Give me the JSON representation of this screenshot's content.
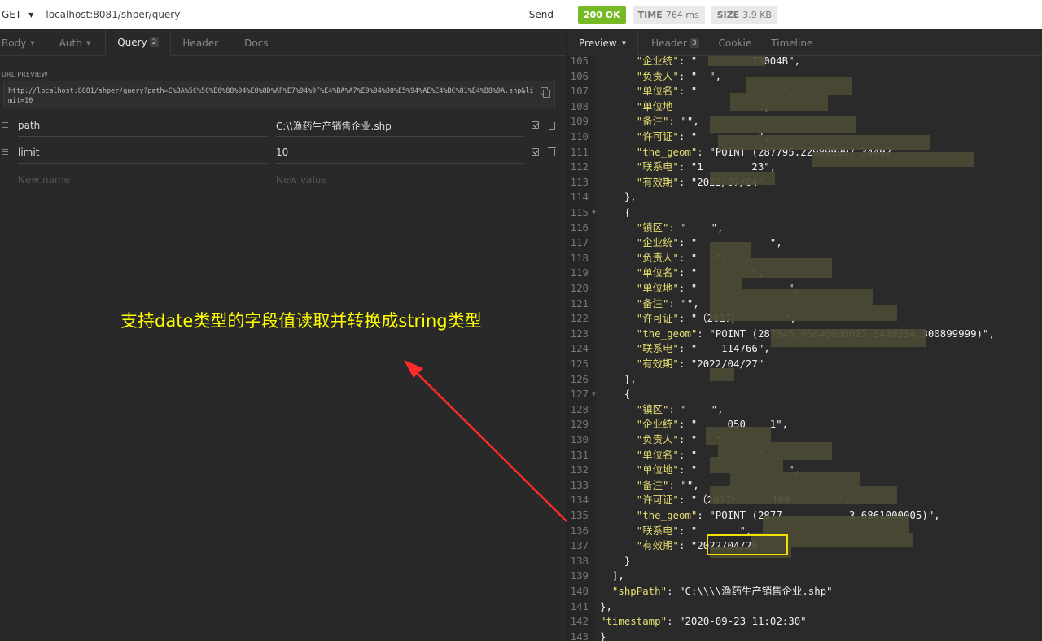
{
  "request": {
    "method": "GET",
    "url": "localhost:8081/shper/query",
    "send_label": "Send"
  },
  "response_meta": {
    "status": "200 OK",
    "time_label": "TIME",
    "time_value": "764 ms",
    "size_label": "SIZE",
    "size_value": "3.9 KB"
  },
  "left_tabs": [
    {
      "label": "Body"
    },
    {
      "label": "Auth"
    },
    {
      "label": "Query",
      "badge": "2"
    },
    {
      "label": "Header"
    },
    {
      "label": "Docs"
    }
  ],
  "url_preview": {
    "label": "URL PREVIEW",
    "text": "http://localhost:8081/shper/query?path=C%3A%5C%5C%E6%88%94%E8%8D%AF%E7%94%9F%E4%BA%A7%E9%94%80%E5%94%AE%E4%BC%81%E4%B8%9A.shp&limit=10"
  },
  "params": [
    {
      "name": "path",
      "value": "C:\\\\渔药生产销售企业.shp"
    },
    {
      "name": "limit",
      "value": "10"
    }
  ],
  "new_param": {
    "name_placeholder": "New name",
    "value_placeholder": "New value"
  },
  "annotation": "支持date类型的字段值读取并转换成string类型",
  "right_tabs": [
    {
      "label": "Preview"
    },
    {
      "label": "Header",
      "badge": "3"
    },
    {
      "label": "Cookie"
    },
    {
      "label": "Timeline"
    }
  ],
  "code_lines": [
    {
      "n": "105",
      "indent": "      ",
      "key": "\"企业统\"",
      "rest": ": \"         73004B\","
    },
    {
      "n": "106",
      "indent": "      ",
      "key": "\"负责人\"",
      "rest": ": \"  \","
    },
    {
      "n": "107",
      "indent": "      ",
      "key": "\"单位名\"",
      "rest": ": \"              \","
    },
    {
      "n": "108",
      "indent": "      ",
      "key": "\"单位地",
      "rest": "              \","
    },
    {
      "n": "109",
      "indent": "      ",
      "key": "\"备注\"",
      "rest": ": \"\","
    },
    {
      "n": "110",
      "indent": "      ",
      "key": "\"许可证\"",
      "rest": ": \"          \","
    },
    {
      "n": "111",
      "indent": "      ",
      "key": "\"the_geom\"",
      "rest": ": \"POINT (287795.229899997 34492"
    },
    {
      "n": "112",
      "indent": "      ",
      "key": "\"联系电\"",
      "rest": ": \"1        23\","
    },
    {
      "n": "113",
      "indent": "      ",
      "key": "\"有效期\"",
      "rest": ": \"2022/07/04\""
    },
    {
      "n": "114",
      "indent": "    ",
      "key": "",
      "rest": "},"
    },
    {
      "n": "115",
      "indent": "    ",
      "key": "",
      "rest": "{",
      "fold": true
    },
    {
      "n": "116",
      "indent": "      ",
      "key": "\"镇区\"",
      "rest": ": \"    \","
    },
    {
      "n": "117",
      "indent": "      ",
      "key": "\"企业统\"",
      "rest": ": \"            \","
    },
    {
      "n": "118",
      "indent": "      ",
      "key": "\"负责人\"",
      "rest": ": \"   \","
    },
    {
      "n": "119",
      "indent": "      ",
      "key": "\"单位名\"",
      "rest": ": \"         \","
    },
    {
      "n": "120",
      "indent": "      ",
      "key": "\"单位地\"",
      "rest": ": \"               \","
    },
    {
      "n": "121",
      "indent": "      ",
      "key": "\"备注\"",
      "rest": ": \"\","
    },
    {
      "n": "122",
      "indent": "      ",
      "key": "\"许可证\"",
      "rest": ": \"（2017）       \","
    },
    {
      "n": "123",
      "indent": "      ",
      "key": "\"the_geom\"",
      "rest": ": \"POINT (287846.96640000027 3449234.300899999)\","
    },
    {
      "n": "124",
      "indent": "      ",
      "key": "\"联系电\"",
      "rest": ": \"    114766\","
    },
    {
      "n": "125",
      "indent": "      ",
      "key": "\"有效期\"",
      "rest": ": \"2022/04/27\""
    },
    {
      "n": "126",
      "indent": "    ",
      "key": "",
      "rest": "},"
    },
    {
      "n": "127",
      "indent": "    ",
      "key": "",
      "rest": "{",
      "fold": true
    },
    {
      "n": "128",
      "indent": "      ",
      "key": "\"镇区\"",
      "rest": ": \"    \","
    },
    {
      "n": "129",
      "indent": "      ",
      "key": "\"企业统\"",
      "rest": ": \"     050    1\","
    },
    {
      "n": "130",
      "indent": "      ",
      "key": "\"负责人\"",
      "rest": ": \"   \","
    },
    {
      "n": "131",
      "indent": "      ",
      "key": "\"单位名\"",
      "rest": ": \"          \","
    },
    {
      "n": "132",
      "indent": "      ",
      "key": "\"单位地\"",
      "rest": ": \"               \","
    },
    {
      "n": "133",
      "indent": "      ",
      "key": "\"备注\"",
      "rest": ": \"\","
    },
    {
      "n": "134",
      "indent": "      ",
      "key": "\"许可证\"",
      "rest": ": \"（2017）     100        \","
    },
    {
      "n": "135",
      "indent": "      ",
      "key": "\"the_geom\"",
      "rest": ": \"POINT (2877           3.6861000005)\","
    },
    {
      "n": "136",
      "indent": "      ",
      "key": "\"联系电\"",
      "rest": ": \"       \","
    },
    {
      "n": "137",
      "indent": "      ",
      "key": "\"有效期\"",
      "rest": ": \"2022/04/26\""
    },
    {
      "n": "138",
      "indent": "    ",
      "key": "",
      "rest": "}"
    },
    {
      "n": "139",
      "indent": "  ",
      "key": "",
      "rest": "],"
    },
    {
      "n": "140",
      "indent": "  ",
      "key": "\"shpPath\"",
      "rest": ": \"C:\\\\\\\\渔药生产销售企业.shp\""
    },
    {
      "n": "141",
      "indent": "",
      "key": "",
      "rest": "},"
    },
    {
      "n": "142",
      "indent": "",
      "key": "\"timestamp\"",
      "rest": ": \"2020-09-23 11:02:30\""
    },
    {
      "n": "143",
      "indent": "",
      "key": "",
      "rest": "}"
    }
  ],
  "colors": {
    "status_ok": "#75ba24",
    "json_key": "#e6de72",
    "annotation": "#ffff00",
    "arrow": "#ff2a2a",
    "highlight_box": "#f2e000"
  }
}
